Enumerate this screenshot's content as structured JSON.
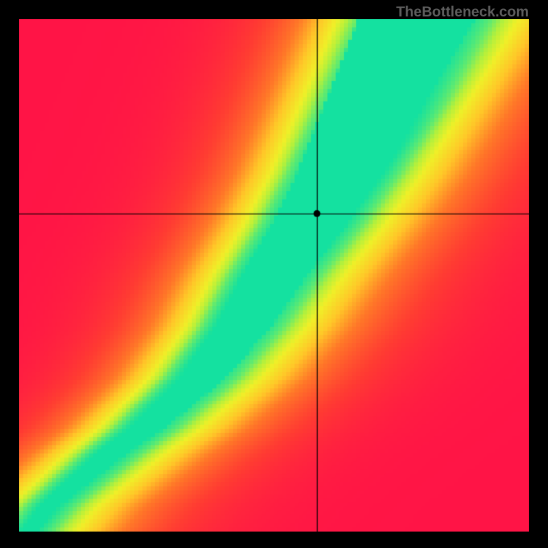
{
  "watermark": "TheBottleneck.com",
  "chart_data": {
    "type": "heatmap",
    "title": "",
    "xlabel": "",
    "ylabel": "",
    "xlim": [
      0,
      1
    ],
    "ylim": [
      0,
      1
    ],
    "crosshair": {
      "x": 0.585,
      "y": 0.62
    },
    "marker": {
      "x": 0.585,
      "y": 0.62
    },
    "grid": false,
    "legend": false,
    "description": "2D heatmap gradient. Value peaks (green) along a diagonal ridge curving from bottom-left (0,0) toward upper-right, slightly right of the main diagonal. Falloff to yellow then orange then red away from the ridge. Upper-left and lower-right corners are deepest red. Black crosshair lines intersect at (0.585, 0.62) with a small black dot."
  }
}
